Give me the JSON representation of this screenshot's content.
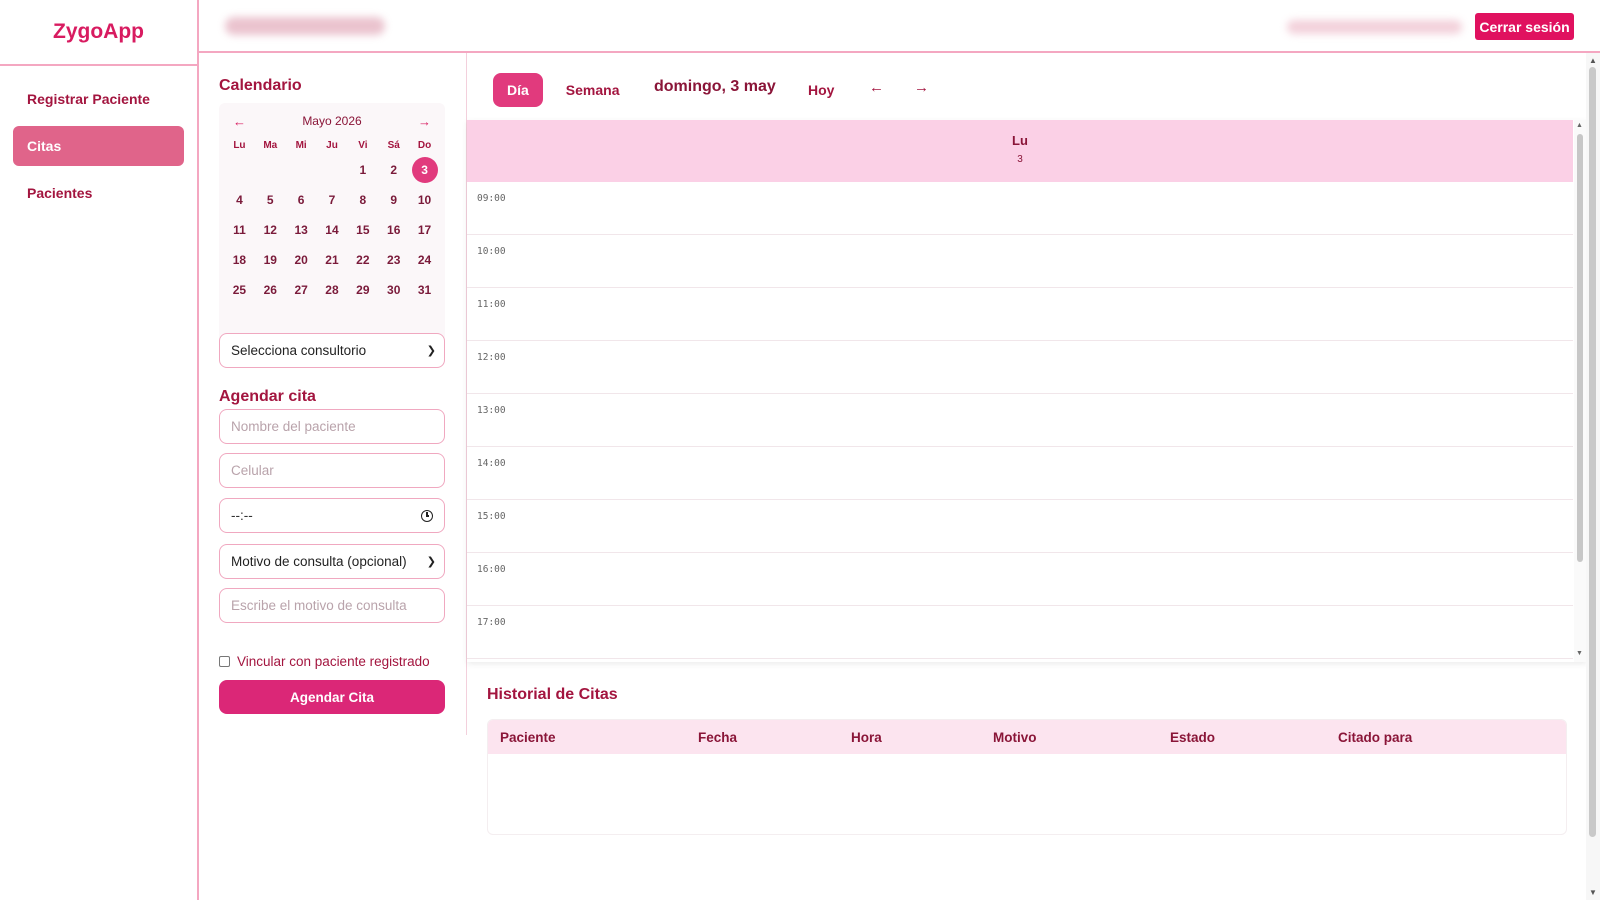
{
  "app": {
    "brand": "ZygoApp"
  },
  "sidebar": {
    "items": [
      {
        "label": "Registrar Paciente",
        "active": false
      },
      {
        "label": "Citas",
        "active": true
      },
      {
        "label": "Pacientes",
        "active": false
      }
    ]
  },
  "header": {
    "logout_label": "Cerrar sesión"
  },
  "calendar_panel": {
    "title": "Calendario",
    "month_label": "Mayo 2026",
    "prev_arrow": "←",
    "next_arrow": "→",
    "weekdays": [
      "Lu",
      "Ma",
      "Mi",
      "Ju",
      "Vi",
      "Sá",
      "Do"
    ],
    "leading_blanks": 4,
    "days": [
      "1",
      "2",
      "3",
      "4",
      "5",
      "6",
      "7",
      "8",
      "9",
      "10",
      "11",
      "12",
      "13",
      "14",
      "15",
      "16",
      "17",
      "18",
      "19",
      "20",
      "21",
      "22",
      "23",
      "24",
      "25",
      "26",
      "27",
      "28",
      "29",
      "30",
      "31"
    ],
    "selected_day": "3"
  },
  "form": {
    "consultorio_select": "Selecciona consultorio",
    "agendar_title": "Agendar cita",
    "nombre_placeholder": "Nombre del paciente",
    "celular_placeholder": "Celular",
    "time_value": "--:--",
    "motivo_select": "Motivo de consulta (opcional)",
    "motivo_placeholder": "Escribe el motivo de consulta",
    "vincular_label": "Vincular con paciente registrado",
    "submit_label": "Agendar Cita"
  },
  "scheduler": {
    "tab_day": "Día",
    "tab_week": "Semana",
    "date_label": "domingo, 3 may",
    "today_label": "Hoy",
    "prev_arrow": "←",
    "next_arrow": "→",
    "column_day_name": "Lu",
    "column_day_num": "3",
    "time_slots": [
      "09:00",
      "10:00",
      "11:00",
      "12:00",
      "13:00",
      "14:00",
      "15:00",
      "16:00",
      "17:00"
    ]
  },
  "history": {
    "title": "Historial de Citas",
    "columns": [
      "Paciente",
      "Fecha",
      "Hora",
      "Motivo",
      "Estado",
      "Citado para"
    ],
    "rows": []
  },
  "colors": {
    "accent": "#e0115f",
    "primary_button": "#db2777",
    "sidebar_active": "#e0648a",
    "day_header": "#fbd0e6",
    "text": "#8a1538"
  }
}
